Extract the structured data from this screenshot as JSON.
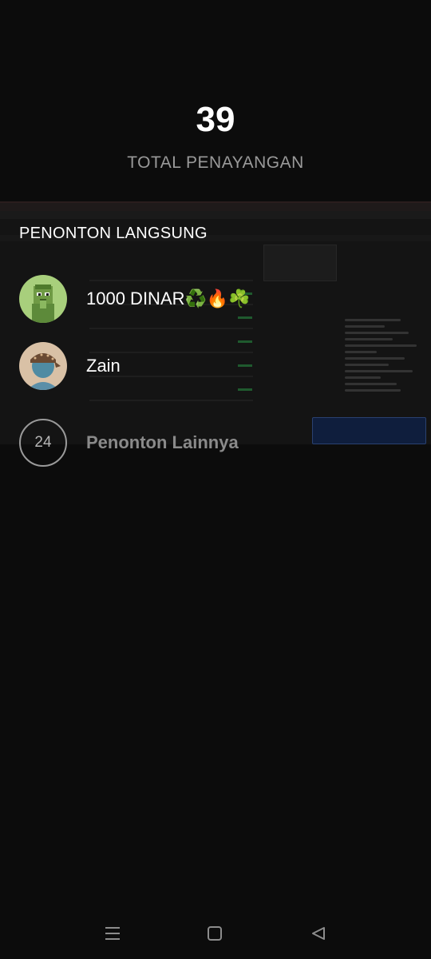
{
  "stats": {
    "total_views": "39",
    "total_views_label": "TOTAL PENAYANGAN"
  },
  "live_viewers": {
    "title": "PENONTON LANGSUNG",
    "items": [
      {
        "name": "1000 DINAR♻️🔥☘️",
        "avatar": "green-character-avatar"
      },
      {
        "name": "Zain",
        "avatar": "bandana-person-avatar"
      }
    ],
    "others": {
      "count": "24",
      "label": "Penonton Lainnya"
    }
  },
  "navigation": {
    "icons": [
      "menu-icon",
      "home-square-icon",
      "back-triangle-icon"
    ]
  },
  "colors": {
    "background": "#0c0c0c",
    "muted_text": "#9a9a9a",
    "others_text": "#8a8a8a"
  }
}
